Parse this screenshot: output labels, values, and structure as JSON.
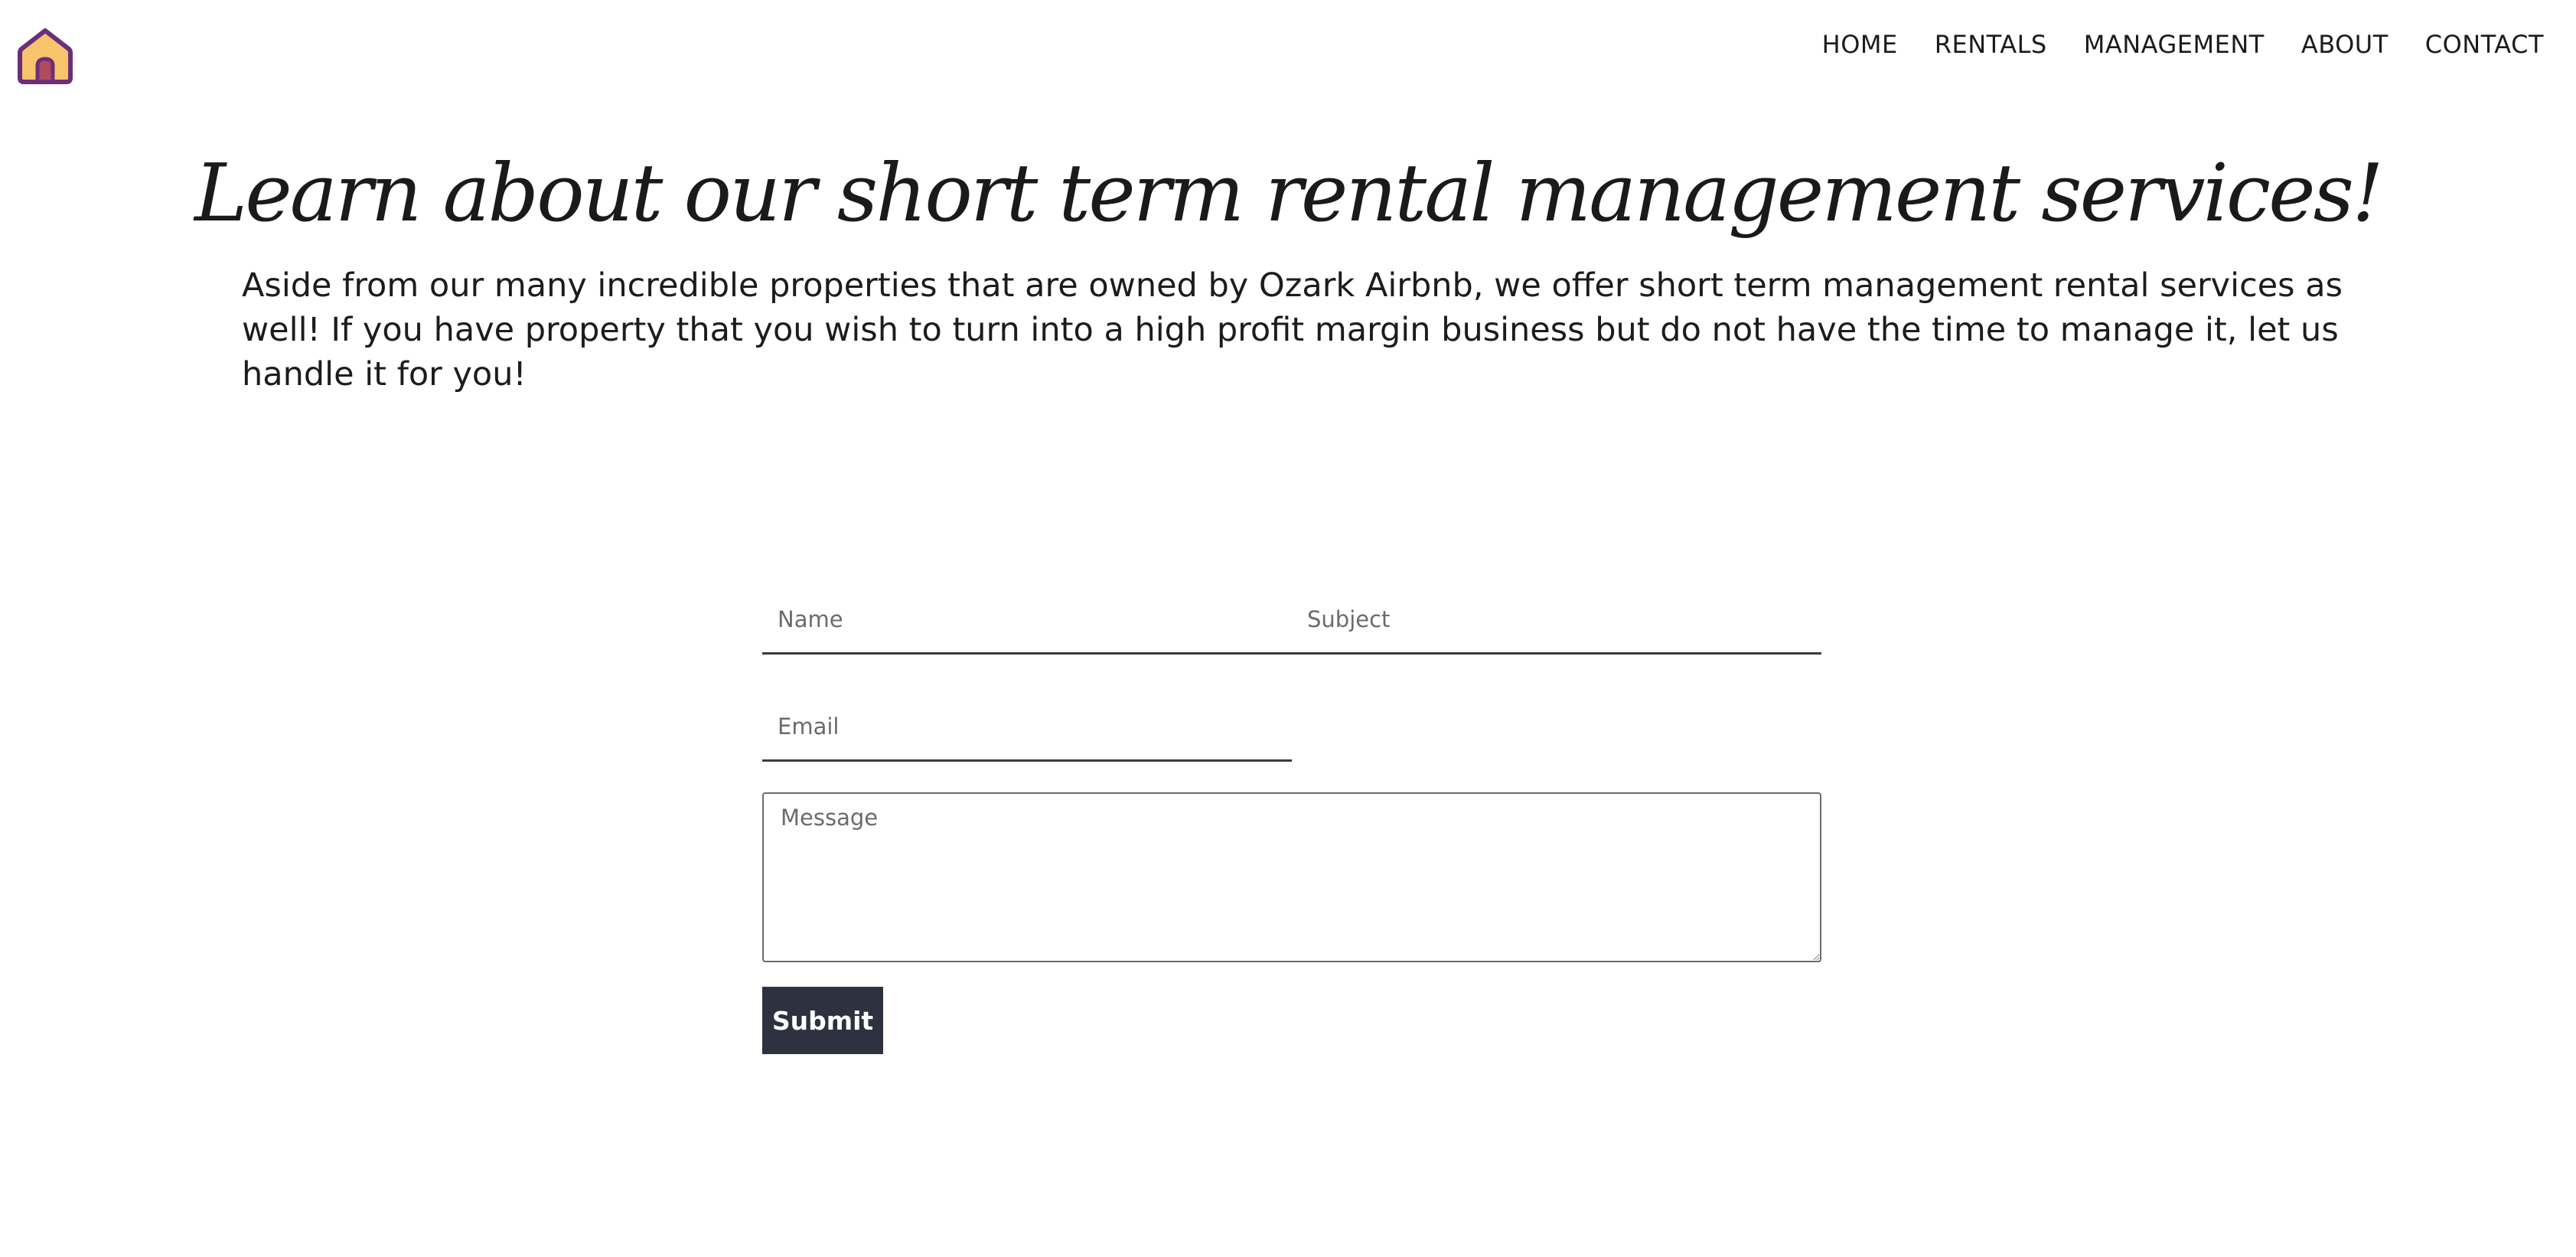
{
  "header": {
    "logo_icon": "house-icon",
    "nav": [
      {
        "label": "HOME"
      },
      {
        "label": "RENTALS"
      },
      {
        "label": "MANAGEMENT"
      },
      {
        "label": "ABOUT"
      },
      {
        "label": "CONTACT"
      }
    ]
  },
  "hero": {
    "title": "Learn about our short term rental management services!",
    "intro": "Aside from our many incredible properties that are owned by Ozark Airbnb, we offer short term management rental services as well! If you have property that you wish to turn into a high profit margin business but do not have the time to manage it, let us handle it for you!"
  },
  "form": {
    "name_placeholder": "Name",
    "subject_placeholder": "Subject",
    "email_placeholder": "Email",
    "message_placeholder": "Message",
    "submit_label": "Submit"
  },
  "colors": {
    "logo_outline": "#6a2f7a",
    "logo_fill": "#f7c46c",
    "logo_door": "#b24a5e",
    "submit_bg": "#2e3140"
  }
}
